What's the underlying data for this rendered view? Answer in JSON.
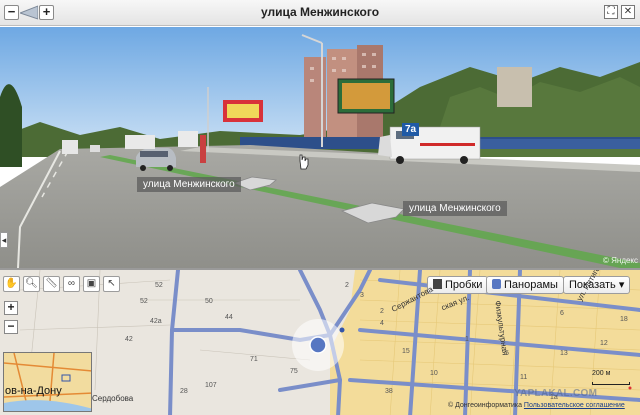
{
  "header": {
    "title": "улица Менжинского",
    "zoom_out": "−",
    "zoom_in": "+",
    "fullscreen_icon": "fullscreen-icon",
    "close_icon": "close-icon"
  },
  "panorama": {
    "labels": [
      "улица Менжинского",
      "улица Менжинского"
    ],
    "route_badge": "7а",
    "brand": "© Яндекс"
  },
  "map": {
    "tools": [
      "hand-icon",
      "magnifier-icon",
      "ruler-icon",
      "link-icon",
      "print-icon",
      "cursor-icon"
    ],
    "zoom_in": "+",
    "zoom_out": "−",
    "layers": {
      "traffic": "Пробки",
      "panoramas": "Панорамы",
      "show": "Показать ▾"
    },
    "minimap_label": "ов-на-Дону",
    "house_numbers": [
      "52",
      "50",
      "42a",
      "44",
      "42",
      "71",
      "75",
      "107",
      "28",
      "2",
      "3",
      "4",
      "15",
      "1",
      "5",
      "13",
      "12",
      "10",
      "11",
      "6",
      "18",
      "38",
      "1a",
      "2",
      "52"
    ],
    "streets": [
      "Сердобова",
      "Физкультурная",
      "Сержантова",
      "ул. Пятигорского",
      "ская ул."
    ],
    "scale_label": "200 м",
    "copyright_prefix": "© Донгеоинформатика",
    "copyright_link": "Пользовательское соглашение",
    "watermark": "YAPLAKAL.COM"
  },
  "colors": {
    "road": "#7a8ec9",
    "block": "#f3dc9a",
    "sky": "#7fb3e6"
  }
}
